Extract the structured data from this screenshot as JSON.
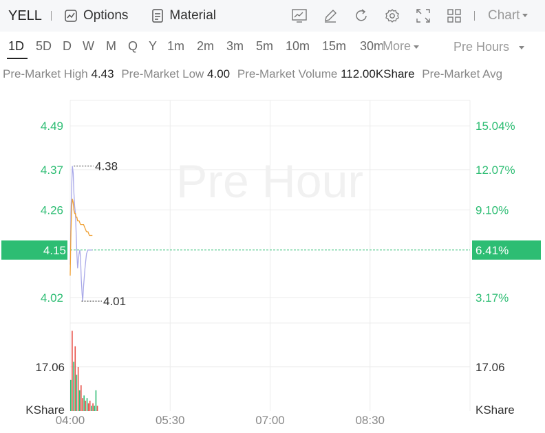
{
  "header": {
    "ticker": "YELL",
    "options_label": "Options",
    "material_label": "Material",
    "chart_label": "Chart"
  },
  "icons": [
    "chart-icon",
    "pencil-icon",
    "refresh-icon",
    "gear-icon",
    "fullscreen-icon",
    "grid-icon"
  ],
  "periods": [
    {
      "label": "1D",
      "active": true
    },
    {
      "label": "5D"
    },
    {
      "label": "D"
    },
    {
      "label": "W"
    },
    {
      "label": "M"
    },
    {
      "label": "Q"
    },
    {
      "label": "Y"
    },
    {
      "label": "1m"
    },
    {
      "label": "2m"
    },
    {
      "label": "3m"
    },
    {
      "label": "5m"
    },
    {
      "label": "10m"
    },
    {
      "label": "15m"
    },
    {
      "label": "30m"
    }
  ],
  "more_label": "More",
  "session_label": "Pre Hours",
  "stats": {
    "high_label": "Pre-Market High",
    "high_value": "4.43",
    "low_label": "Pre-Market Low",
    "low_value": "4.00",
    "volume_label": "Pre-Market Volume",
    "volume_value": "112.00KShare",
    "avg_label": "Pre-Market Avg"
  },
  "colors": {
    "green": "#2dbd73",
    "red": "#e8514a",
    "price_line": "#a8a8e8",
    "avg_line": "#f0a033",
    "grid": "#ececec"
  },
  "chart_data": {
    "type": "line",
    "watermark": "Pre Hour",
    "price_axis": {
      "ticks": [
        4.49,
        4.37,
        4.26,
        4.02
      ],
      "tick_labels": [
        "4.49",
        "4.37",
        "4.26",
        "4.02"
      ],
      "current_label": "4.15",
      "range": [
        3.95,
        4.56
      ]
    },
    "percent_axis": {
      "tick_labels": [
        "15.04%",
        "12.07%",
        "9.10%",
        "3.17%"
      ],
      "current_label": "6.41%"
    },
    "time_axis": {
      "labels": [
        "04:00",
        "05:30",
        "07:00",
        "08:30"
      ],
      "range_minutes": [
        0,
        360
      ]
    },
    "reference_price": 4.15,
    "annotations": [
      {
        "label": "4.38",
        "price": 4.38,
        "minute": 2
      },
      {
        "label": "4.01",
        "price": 4.01,
        "minute": 9
      }
    ],
    "series": [
      {
        "minutes": [
          0,
          0.7,
          1.4,
          2,
          2.7,
          3.3,
          4,
          4.7,
          5.3,
          6,
          6.7,
          7.3,
          8,
          8.7,
          9.3,
          10,
          10.7,
          11.3,
          12,
          13.3,
          14.7,
          16,
          17.3,
          18.7,
          20
        ],
        "prices": [
          4.11,
          4.25,
          4.33,
          4.38,
          4.36,
          4.31,
          4.27,
          4.25,
          4.2,
          4.14,
          4.1,
          4.12,
          4.14,
          4.15,
          4.13,
          4.07,
          4.03,
          4.01,
          4.05,
          4.1,
          4.14,
          4.15,
          4.15,
          4.15,
          4.15
        ]
      },
      {
        "minutes": [
          0,
          0.7,
          1.4,
          2,
          2.7,
          3.3,
          4,
          4.7,
          5.3,
          6,
          6.7,
          8,
          9.3,
          10.7,
          12,
          13.3,
          14.7,
          16,
          17.3,
          18.7,
          20
        ],
        "prices": [
          4.08,
          4.2,
          4.27,
          4.29,
          4.28,
          4.26,
          4.25,
          4.25,
          4.24,
          4.24,
          4.23,
          4.23,
          4.22,
          4.22,
          4.22,
          4.21,
          4.2,
          4.2,
          4.19,
          4.19,
          4.19
        ]
      }
    ],
    "volume_axis": {
      "tick_label": "17.06",
      "tick_value": 17.06,
      "unit_label": "KShare",
      "range": [
        0,
        34
      ]
    },
    "volume": {
      "minutes": [
        0,
        1.3,
        2.7,
        4,
        5.3,
        6.7,
        8,
        9.3,
        10.7,
        12,
        13.3,
        14.7,
        16,
        17.3,
        18.7,
        20,
        21.3,
        22.7,
        24
      ],
      "values": [
        12,
        31,
        19,
        25,
        14,
        17,
        8,
        10,
        5,
        6,
        4,
        5,
        3,
        4,
        2,
        3,
        2,
        8,
        2
      ],
      "up": [
        true,
        false,
        true,
        false,
        true,
        false,
        true,
        false,
        false,
        true,
        false,
        true,
        false,
        false,
        true,
        false,
        true,
        true,
        false
      ]
    }
  }
}
